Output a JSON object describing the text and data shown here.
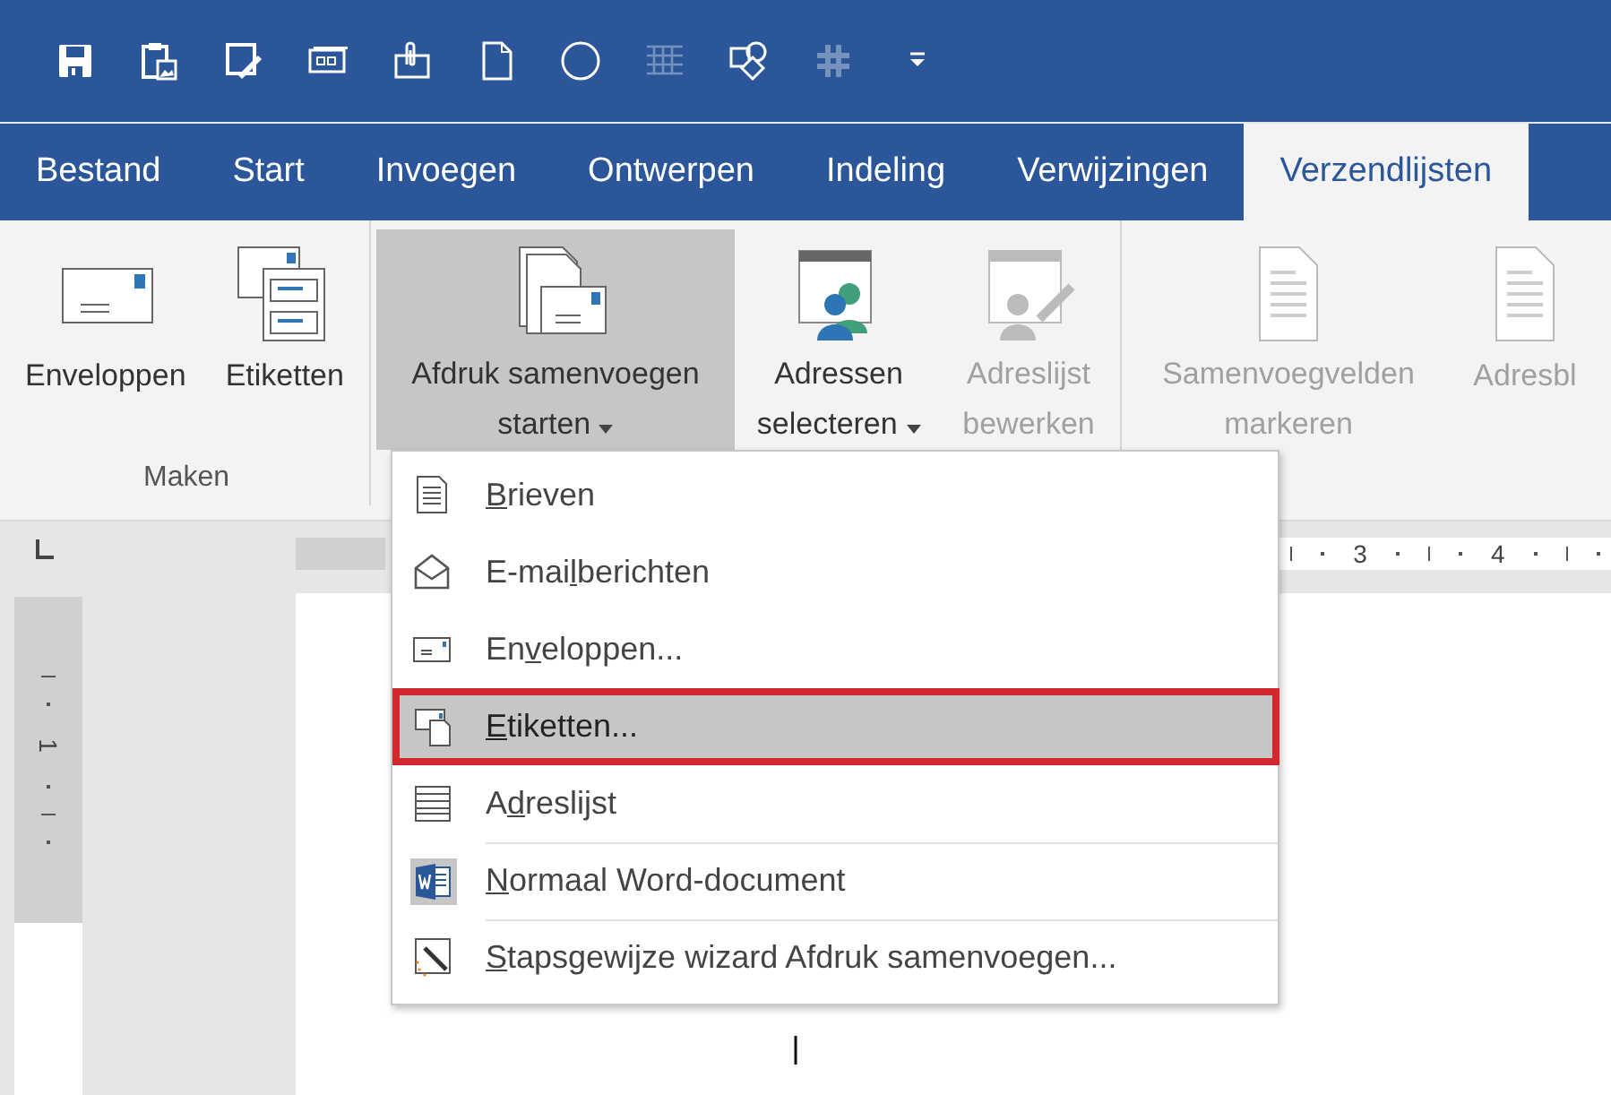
{
  "quick_access": [
    {
      "kind": "save",
      "disabled": false
    },
    {
      "kind": "clipboard",
      "disabled": false
    },
    {
      "kind": "pen",
      "disabled": false
    },
    {
      "kind": "card",
      "disabled": false
    },
    {
      "kind": "clip",
      "disabled": false
    },
    {
      "kind": "page",
      "disabled": false
    },
    {
      "kind": "circle",
      "disabled": false
    },
    {
      "kind": "grid",
      "disabled": true
    },
    {
      "kind": "shapes",
      "disabled": false
    },
    {
      "kind": "hash",
      "disabled": true
    },
    {
      "kind": "more",
      "disabled": false
    }
  ],
  "tabs": [
    {
      "label": "Bestand",
      "selected": false
    },
    {
      "label": "Start",
      "selected": false
    },
    {
      "label": "Invoegen",
      "selected": false
    },
    {
      "label": "Ontwerpen",
      "selected": false
    },
    {
      "label": "Indeling",
      "selected": false
    },
    {
      "label": "Verwijzingen",
      "selected": false
    },
    {
      "label": "Verzendlijsten",
      "selected": true
    }
  ],
  "ribbon": {
    "groups": [
      {
        "label": "Maken",
        "buttons": [
          {
            "kind": "envelope",
            "label": "Enveloppen",
            "disabled": false,
            "dropdown": false,
            "pressed": false
          },
          {
            "kind": "labels",
            "label": "Etiketten",
            "disabled": false,
            "dropdown": false,
            "pressed": false
          }
        ]
      },
      {
        "buttons": [
          {
            "kind": "merge",
            "label": "Afdruk samenvoegen starten",
            "disabled": false,
            "dropdown": true,
            "pressed": true
          },
          {
            "kind": "recipients",
            "label": "Adressen selecteren",
            "disabled": false,
            "dropdown": true,
            "pressed": false
          },
          {
            "kind": "editlist",
            "label": "Adreslijst bewerken",
            "disabled": true,
            "dropdown": false,
            "pressed": false
          }
        ]
      },
      {
        "buttons": [
          {
            "kind": "doc",
            "label": "Samenvoegvelden markeren",
            "disabled": true,
            "dropdown": false,
            "pressed": false
          },
          {
            "kind": "doc",
            "label": "Adresbl",
            "disabled": true,
            "dropdown": false,
            "pressed": false
          }
        ]
      }
    ]
  },
  "ruler": {
    "horizontal_numbers": [
      "3",
      "4"
    ],
    "vertical_numbers": [
      "1"
    ]
  },
  "menu": {
    "items": [
      {
        "kind": "letters",
        "key": "B",
        "post": "rieven",
        "selected": false,
        "separator_before": false
      },
      {
        "kind": "email",
        "pre": "E-mai",
        "key": "l",
        "post": "berichten",
        "selected": false,
        "separator_before": false
      },
      {
        "kind": "envelope",
        "pre": "En",
        "key": "v",
        "post": "eloppen...",
        "selected": false,
        "separator_before": false
      },
      {
        "kind": "labels",
        "key": "E",
        "post": "tiketten...",
        "selected": true,
        "separator_before": false
      },
      {
        "kind": "list",
        "pre": "A",
        "key": "d",
        "post": "reslijst",
        "selected": false,
        "separator_before": false
      },
      {
        "kind": "word",
        "key": "N",
        "post": "ormaal Word-document",
        "selected": false,
        "separator_before": true
      },
      {
        "kind": "wizard",
        "key": "S",
        "post": "tapsgewijze wizard Afdruk samenvoegen...",
        "selected": false,
        "separator_before": true
      }
    ]
  }
}
